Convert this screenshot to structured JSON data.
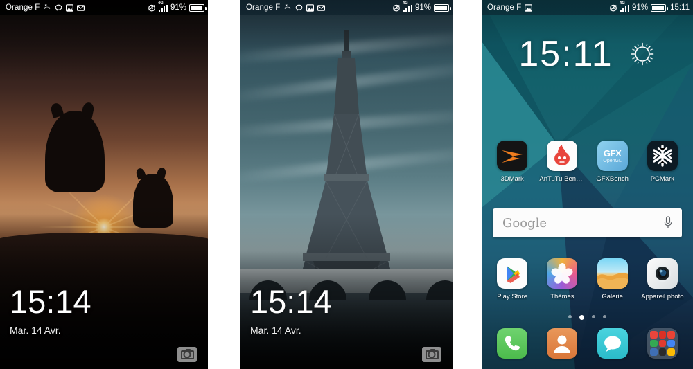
{
  "screens": [
    {
      "id": "lockscreen-cats",
      "type": "lockscreen",
      "wallpaper_name": "cats-sunset-wallpaper",
      "statusbar": {
        "carrier": "Orange F",
        "battery_percent": "91%",
        "network": "4G",
        "icons": [
          "missed-call-icon",
          "chat-bubble-icon",
          "image-icon",
          "mail-icon",
          "alarm-icon",
          "signal-icon",
          "battery-icon"
        ]
      },
      "time": "15:14",
      "date": "Mar. 14 Avr.",
      "camera_shortcut": "camera-icon"
    },
    {
      "id": "lockscreen-eiffel",
      "type": "lockscreen",
      "wallpaper_name": "eiffel-tower-wallpaper",
      "statusbar": {
        "carrier": "Orange F",
        "battery_percent": "91%",
        "network": "4G",
        "icons": [
          "missed-call-icon",
          "chat-bubble-icon",
          "image-icon",
          "mail-icon",
          "alarm-icon",
          "signal-icon",
          "battery-icon"
        ]
      },
      "time": "15:14",
      "date": "Mar. 14 Avr.",
      "camera_shortcut": "camera-icon"
    },
    {
      "id": "homescreen",
      "type": "homescreen",
      "wallpaper_name": "teal-geometric-wallpaper",
      "statusbar": {
        "carrier": "Orange F",
        "battery_percent": "91%",
        "network": "4G",
        "clock": "15:11",
        "icons": [
          "image-icon",
          "alarm-icon",
          "signal-icon",
          "battery-icon"
        ]
      },
      "widget": {
        "time": "15:11",
        "weather_icon": "sun-icon"
      },
      "search": {
        "label": "Google",
        "mic_icon": "microphone-icon"
      },
      "app_rows": [
        {
          "row": 1,
          "apps": [
            {
              "label": "3DMark",
              "icon": "3dmark-icon"
            },
            {
              "label": "AnTuTu Benchm..",
              "icon": "antutu-icon"
            },
            {
              "label": "GFXBench",
              "icon": "gfxbench-icon"
            },
            {
              "label": "PCMark",
              "icon": "pcmark-icon"
            }
          ]
        },
        {
          "row": 2,
          "apps": [
            {
              "label": "Play Store",
              "icon": "play-store-icon"
            },
            {
              "label": "Thèmes",
              "icon": "themes-icon"
            },
            {
              "label": "Galerie",
              "icon": "gallery-icon"
            },
            {
              "label": "Appareil photo",
              "icon": "camera-app-icon"
            }
          ]
        }
      ],
      "dock": [
        {
          "label": "",
          "icon": "phone-icon"
        },
        {
          "label": "",
          "icon": "contacts-icon"
        },
        {
          "label": "",
          "icon": "messages-icon"
        },
        {
          "label": "",
          "icon": "app-folder-icon"
        }
      ],
      "page_indicator": {
        "total": 4,
        "active": 2
      }
    }
  ],
  "colors": {
    "phone_green": "#5ec85e",
    "contacts_orange": "#e08a4b",
    "messages_cyan": "#3fc8d4",
    "gfx_blue": "#6db6e0",
    "antutu_red": "#e8453c",
    "gallery_orange": "#f0a84c",
    "status_bar_dark": "#0a0a0a"
  }
}
